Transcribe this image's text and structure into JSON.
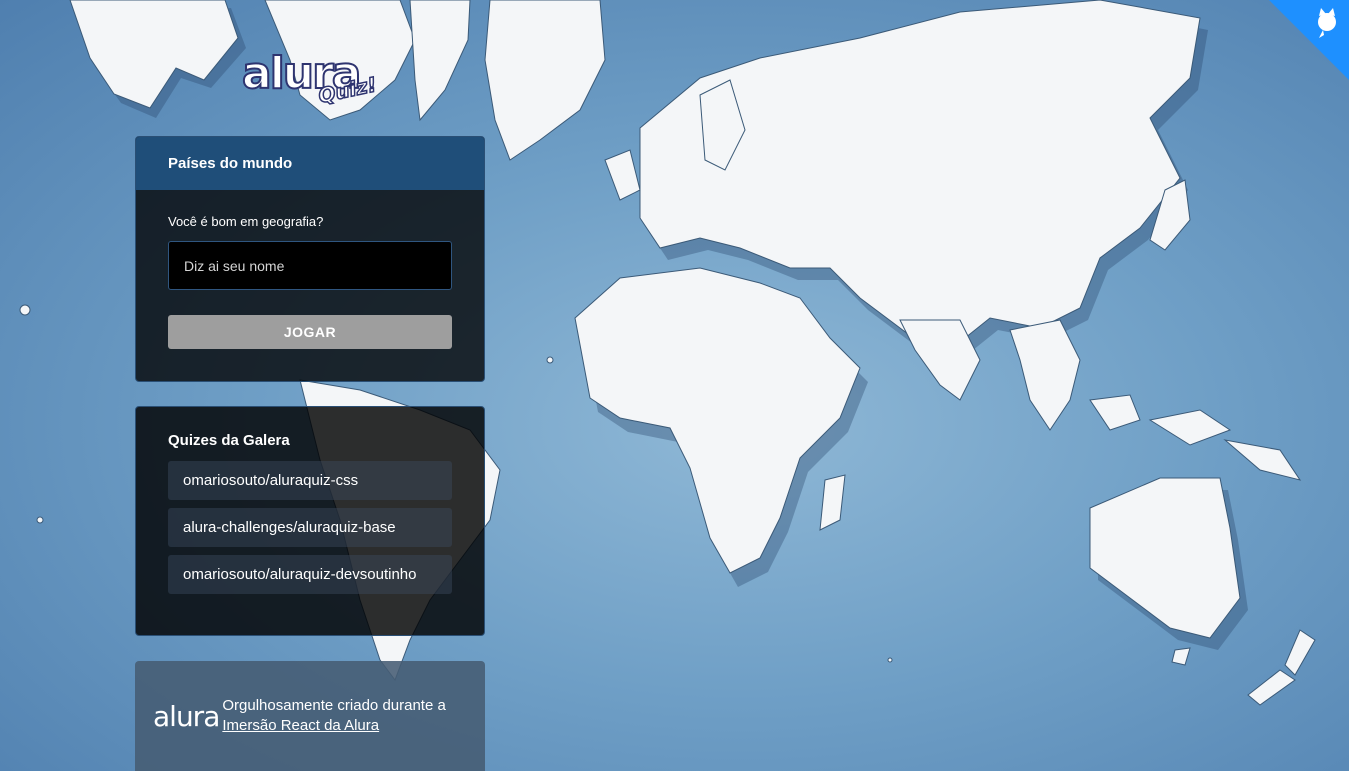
{
  "logo": {
    "word": "alura",
    "tag": "Quiz!"
  },
  "main_widget": {
    "title": "Países do mundo",
    "question": "Você é bom em geografia?",
    "name_input": {
      "placeholder": "Diz ai seu nome",
      "value": ""
    },
    "play_button": "JOGAR"
  },
  "gallery_widget": {
    "title": "Quizes da Galera",
    "items": [
      "omariosouto/aluraquiz-css",
      "alura-challenges/aluraquiz-base",
      "omariosouto/aluraquiz-devsoutinho"
    ]
  },
  "footer": {
    "brand": "alura",
    "text": "Orgulhosamente criado durante a",
    "link": "Imersão React da Alura"
  },
  "github_corner": {
    "icon": "github-octocat-icon",
    "color": "#1e90ff"
  },
  "colors": {
    "header": "#1f4e79",
    "button": "#9e9e9e",
    "ocean": "#6f9fc6"
  }
}
